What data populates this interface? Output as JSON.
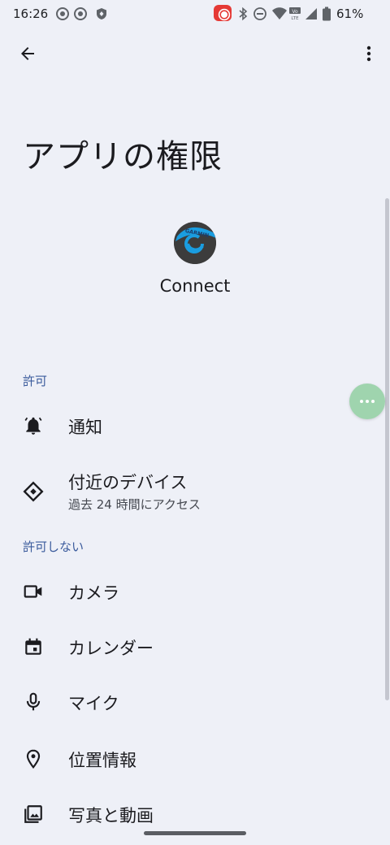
{
  "status_bar": {
    "time": "16:26",
    "battery": "61%",
    "icons": [
      "screen-record-icon",
      "screen-record-icon",
      "shield-icon",
      "recording-badge-icon",
      "bluetooth-icon",
      "dnd-icon",
      "wifi-icon",
      "volte-icon",
      "signal-icon",
      "battery-icon"
    ]
  },
  "toolbar": {
    "back_icon": "arrow-back-icon",
    "menu_icon": "more-vert-icon"
  },
  "page": {
    "title": "アプリの権限"
  },
  "app": {
    "name": "Connect",
    "icon_text": "GARMIN",
    "icon_colors": {
      "background": "#3c3c3c",
      "accent": "#1a9de0"
    }
  },
  "sections": {
    "allowed_header": "許可",
    "denied_header": "許可しない"
  },
  "permissions": {
    "allowed": [
      {
        "label": "通知",
        "icon": "bell-icon"
      },
      {
        "label": "付近のデバイス",
        "subtitle": "過去 24 時間にアクセス",
        "icon": "nearby-devices-icon"
      }
    ],
    "denied": [
      {
        "label": "カメラ",
        "icon": "camera-icon"
      },
      {
        "label": "カレンダー",
        "icon": "calendar-icon"
      },
      {
        "label": "マイク",
        "icon": "mic-icon"
      },
      {
        "label": "位置情報",
        "icon": "location-icon"
      },
      {
        "label": "写真と動画",
        "icon": "photo-icon"
      }
    ]
  },
  "colors": {
    "background": "#eef0f7",
    "section_header": "#3b5b9c",
    "bubble": "#9fd4ae"
  }
}
